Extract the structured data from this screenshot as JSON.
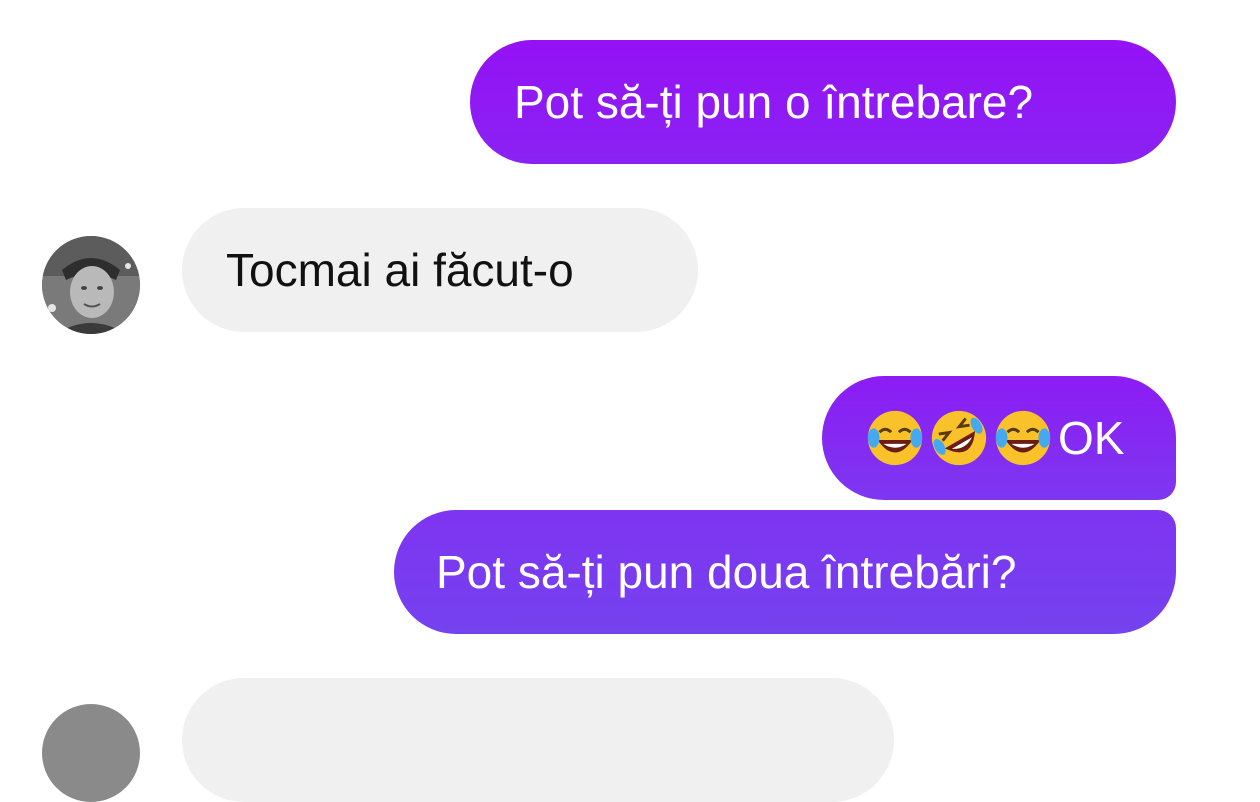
{
  "colors": {
    "outgoing_gradient_start": "#9412f5",
    "outgoing_gradient_end": "#7a3ef0",
    "incoming_bg": "#f0f0f0",
    "outgoing_text": "#ffffff",
    "incoming_text": "#111111"
  },
  "messages": [
    {
      "direction": "outgoing",
      "text": "Pot să-ți pun o întrebare?"
    },
    {
      "direction": "incoming",
      "text": "Tocmai ai făcut-o",
      "avatar": "contact-avatar"
    },
    {
      "direction": "outgoing",
      "emojis": [
        "joy-emoji",
        "rolling-on-floor-laughing-emoji",
        "joy-emoji"
      ],
      "text": "OK"
    },
    {
      "direction": "outgoing",
      "text": "Pot să-ți pun doua întrebări?"
    },
    {
      "direction": "incoming",
      "text": "",
      "avatar": "contact-avatar"
    }
  ]
}
